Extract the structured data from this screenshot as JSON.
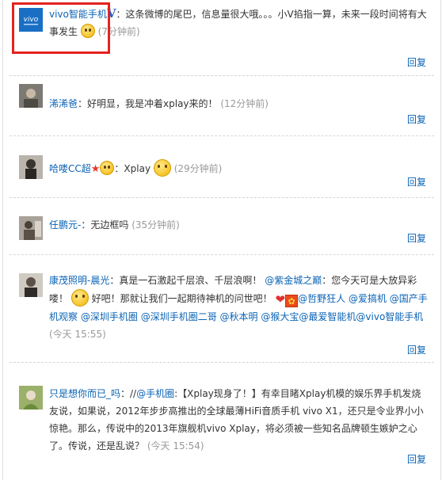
{
  "comments": [
    {
      "user": "vivo智能手机",
      "verified_mark": "V",
      "text": "：这条微博的尾巴，信息量很大哦。。。小V掐指一算，未来一段时间将有大事发生",
      "time": "(7分钟前)",
      "reply": "回复"
    },
    {
      "user": "浠浠爸",
      "text": "：好明显，我是冲着xplay来的！",
      "time": "(12分钟前)",
      "reply": "回复"
    },
    {
      "user": "哈喽CC超",
      "text": "：Xplay",
      "time": "(29分钟前)",
      "reply": "回复"
    },
    {
      "user": "任鹏元-",
      "text": "：无边框吗",
      "time": "(35分钟前)",
      "reply": "回复"
    },
    {
      "user": "康茂照明-晨光",
      "text_a": "：真是一石激起千层浪、千层浪啊！",
      "mention_a": "@紫金城之巅",
      "text_b": "：您今天可是大放异彩喽！",
      "text_c": "好吧！那就让我们一起期待神机的问世吧！",
      "mentions": [
        "@哲野狂人",
        "@爱搞机",
        "@国产手机观察",
        "@深圳手机圈",
        "@深圳手机圈二哥",
        "@秋本明",
        "@猴大宝",
        "@最爱智能机",
        "@vivo智能手机"
      ],
      "time": "(今天 15:55)",
      "reply": "回复"
    },
    {
      "user": "只是想你而已_吗",
      "text_a": "：//",
      "mention_a": "@手机圈",
      "text_b": ":【Xplay现身了！】有幸目睹Xplay机模的娱乐界手机发烧友说，如果说，2012年步步高推出的全球最薄HiFi音质手机 vivo X1，还只是令业界小小惊艳。那么，传说中的2013年旗舰机vivo Xplay，将必须被一些知名品牌顿生嫉妒之心了。传说，还是乱说？",
      "time": "(今天 15:54)",
      "reply": "回复"
    }
  ],
  "colors": {
    "link": "#0a63b4",
    "time": "#999999",
    "highlight": "#e2231f",
    "verified": "#1f5cc7"
  },
  "icons": [
    "vivo-logo-avatar",
    "smile-emoji",
    "heart-emoji",
    "red-square-emoji",
    "star-badge-icon"
  ]
}
